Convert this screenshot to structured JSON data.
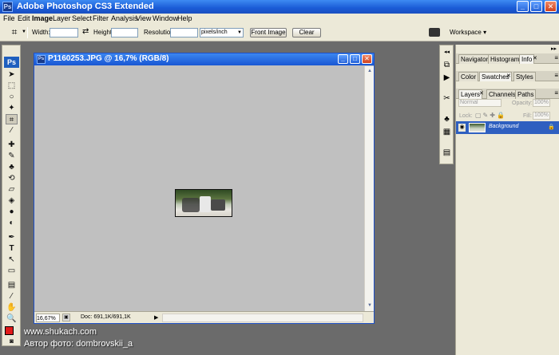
{
  "window": {
    "title": "Adobe Photoshop CS3 Extended",
    "minimize": "_",
    "maximize": "□",
    "close": "✕",
    "app_icon": "Ps"
  },
  "menu": [
    "File",
    "Edit",
    "Image",
    "Layer",
    "Select",
    "Filter",
    "Analysis",
    "View",
    "Window",
    "Help"
  ],
  "options": {
    "width_label": "Width:",
    "height_label": "Height:",
    "resolution_label": "Resolution:",
    "units_value": "pixels/inch",
    "front_image": "Front Image",
    "clear": "Clear",
    "workspace": "Workspace ▾",
    "crop_icon": "crop-tool-icon",
    "swap_icon": "⇄"
  },
  "tools": {
    "logo": "Ps"
  },
  "document": {
    "title": "P1160253.JPG @ 16,7% (RGB/8)",
    "icon": "Ps",
    "zoom": "16,67%",
    "doc_info": "Doc: 691,1K/691,1K"
  },
  "panels": {
    "group1": [
      "Navigator",
      "Histogram",
      "Info"
    ],
    "group2": [
      "Color",
      "Swatches",
      "Styles"
    ],
    "group3": [
      "Layers",
      "Channels",
      "Paths"
    ],
    "blend_mode": "Normal",
    "opacity_label": "Opacity:",
    "opacity_value": "100%",
    "lock_label": "Lock:",
    "fill_label": "Fill:",
    "fill_value": "100%",
    "layer_name": "Background"
  },
  "watermark": {
    "line1": "www.shukach.com",
    "line2": "Автор фото: dombrovskii_a"
  },
  "colors": {
    "accent": "#1856d3",
    "foreground": "#e11b1b",
    "background": "#ffffff"
  }
}
